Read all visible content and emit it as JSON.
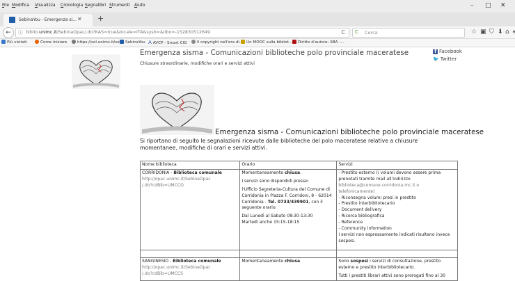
{
  "menubar": {
    "items": [
      "File",
      "Modifica",
      "Visualizza",
      "Cronologia",
      "Segnalibri",
      "Strumenti",
      "Aiuto"
    ],
    "underlines": [
      "F",
      "M",
      "V",
      "C",
      "S",
      "S",
      "A"
    ],
    "controls": [
      "–",
      "□",
      "✕"
    ]
  },
  "tab": {
    "title": "SebinaYou - Emergenza si...",
    "close": "✕",
    "new": "+"
  },
  "nav": {
    "back": "←",
    "info": "ⓘ",
    "url_prefix": "biblio.",
    "url_domain": "unimc.it",
    "url_rest": "/SebinaOpac/.do?KAS=true&locale=ITA&sysb=&iIbo=-152830512649",
    "reload": "C",
    "search_placeholder": "Cerca",
    "icons": [
      "☆",
      "▣",
      "⛉",
      "⬇",
      "⌂",
      "≡"
    ]
  },
  "bookmarks": [
    {
      "label": "Più visitati",
      "color": "#3a78c9"
    },
    {
      "label": "Come iniziare",
      "color": "#e66000"
    },
    {
      "label": "https://sol.unimc.it/se...",
      "color": "#777777"
    },
    {
      "label": "SebinaYou",
      "color": "#1f5da8"
    },
    {
      "label": "AVCP - Smart CIG",
      "color": "#2b5aa8"
    },
    {
      "label": "Il copyright nell'era di...",
      "color": "#888888"
    },
    {
      "label": "Un MOOC sulla bibliot...",
      "color": "#c8a000"
    },
    {
      "label": "Diritto d'autore: SBA -...",
      "color": "#b01010"
    }
  ],
  "page": {
    "header_title": "Emergenza sisma - Comunicazioni biblioteche polo provinciale maceratese",
    "header_sub": "Chiusure straordinarie, modifiche orari e servizi attivi",
    "facebook": "Facebook",
    "twitter": "Twitter",
    "article_title": "Emergenza sisma - Comunicazioni biblioteche polo provinciale maceratese",
    "intro": "Si riportano di seguito le segnalazioni ricevute dalle biblioteche del polo maceratese relative a chiusure momentanee, modifiche di orari e servizi attivi."
  },
  "table": {
    "headers": [
      "Nome biblioteca",
      "Orario",
      "Servizi"
    ],
    "row1": {
      "name_prefix": "CORRIDONIA - ",
      "name_bold": "Biblioteca comunale",
      "link1": "http://opac.unimc.it/SebinaOpac",
      "link2": "/.do?cdBib=UMCCO",
      "orario_pre": "Momentaneamente ",
      "orario_bold": "chiusa",
      "orario_post": ".",
      "orario_l2": "I servizi sono disponibili presso:",
      "orario_l3": "l'Ufficio Segreteria-Cultura del Comune di Corridonia in Piazza F. Corridoni, 8 - 62014 Corridonia - ",
      "orario_tel": "Tel. 0733/439901",
      "orario_l3b": ", con il seguente orario:",
      "orario_l4": "Dal Lunedì al Sabato 08:30-13:30",
      "orario_l5": "Martedì anche 15:15-18:15",
      "servizi": [
        "- Prestito esterno (i volumi devono essere prima prenotati tramite mail all'indirizzo",
        "biblioteca@comune.corridonia.mc.it o telefonicamente)",
        "- Riconsegna volumi presi in prestito",
        "- Prestito interbibliotecario",
        "- Document delivery",
        "- Ricerca bibliografica",
        "- Reference",
        "- Community information",
        "I servizi non espressamente indicati risultano invece sospesi."
      ]
    },
    "row2": {
      "name_prefix": "SANGINESIO - ",
      "name_bold": "Biblioteca comunale",
      "link1": "http://opac.unimc.it/SebinaOpac",
      "link2": "/.do?cdBib=UMCCS",
      "orario_pre": "Momentaneamente ",
      "orario_bold": "chiusa",
      "servizi_pre": "Sono ",
      "servizi_bold": "sospesi",
      "servizi_post": " i servizi di consultazione, prestito esterno e prestito interbibliotecario.",
      "servizi_l2": "Tutti i prestiti librari attivi sono prorogati fino al 30"
    }
  }
}
